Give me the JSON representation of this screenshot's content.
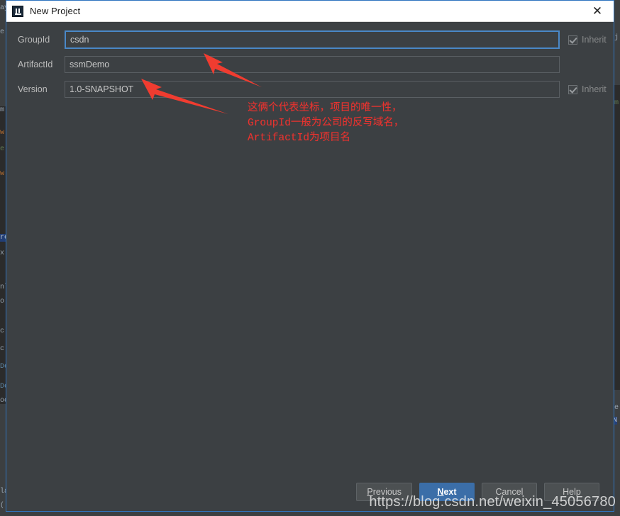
{
  "window": {
    "title": "New Project",
    "app_icon": "intellij-idea-icon",
    "close_icon": "close-icon",
    "accent_color": "#3b6ea8",
    "dialog_background": "#3c4043",
    "focus_border_color": "#4a88c7"
  },
  "form": {
    "fields": [
      {
        "label": "GroupId",
        "value": "csdn",
        "focused": true,
        "inherit_label": "Inherit",
        "inherit_checked": true,
        "has_inherit": true
      },
      {
        "label": "ArtifactId",
        "value": "ssmDemo",
        "focused": false,
        "inherit_label": "",
        "inherit_checked": false,
        "has_inherit": false
      },
      {
        "label": "Version",
        "value": "1.0-SNAPSHOT",
        "focused": false,
        "inherit_label": "Inherit",
        "inherit_checked": true,
        "has_inherit": true
      }
    ]
  },
  "annotations": {
    "color": "#e8332f",
    "note_lines": [
      "这俩个代表坐标，项目的唯一性，",
      "GroupId一般为公司的反写域名，",
      "ArtifactId为项目名"
    ],
    "note_text": "这俩个代表坐标，项目的唯一性，\nGroupId一般为公司的反写域名，\nArtifactId为项目名",
    "arrows": [
      {
        "name": "arrow-to-groupid",
        "points_at": "GroupId field"
      },
      {
        "name": "arrow-to-artifactid",
        "points_at": "ArtifactId field"
      }
    ]
  },
  "footer": {
    "buttons": [
      {
        "label": "Previous",
        "mnemonic": "P",
        "primary": false
      },
      {
        "label": "Next",
        "mnemonic": "N",
        "primary": true
      },
      {
        "label": "Cancel",
        "mnemonic": "",
        "primary": false
      },
      {
        "label": "Help",
        "mnemonic": "",
        "primary": false
      }
    ],
    "previous_pre": "",
    "previous_mnem": "P",
    "previous_post": "revious",
    "next_pre": "",
    "next_mnem": "N",
    "next_post": "ext",
    "cancel_label": "Cancel",
    "help_label": "Help"
  },
  "watermark": {
    "text": "https://blog.csdn.net/weixin_45056780"
  },
  "backdrop": {
    "ghost_lines": [
      "ay",
      "e",
      "m",
      "w",
      "e",
      "w",
      "re",
      "x.",
      "nl",
      "o",
      "c",
      "c",
      "De",
      "De",
      "oc",
      "la",
      "("
    ],
    "right_ghost": [
      "j",
      "m",
      "e",
      "N"
    ]
  }
}
